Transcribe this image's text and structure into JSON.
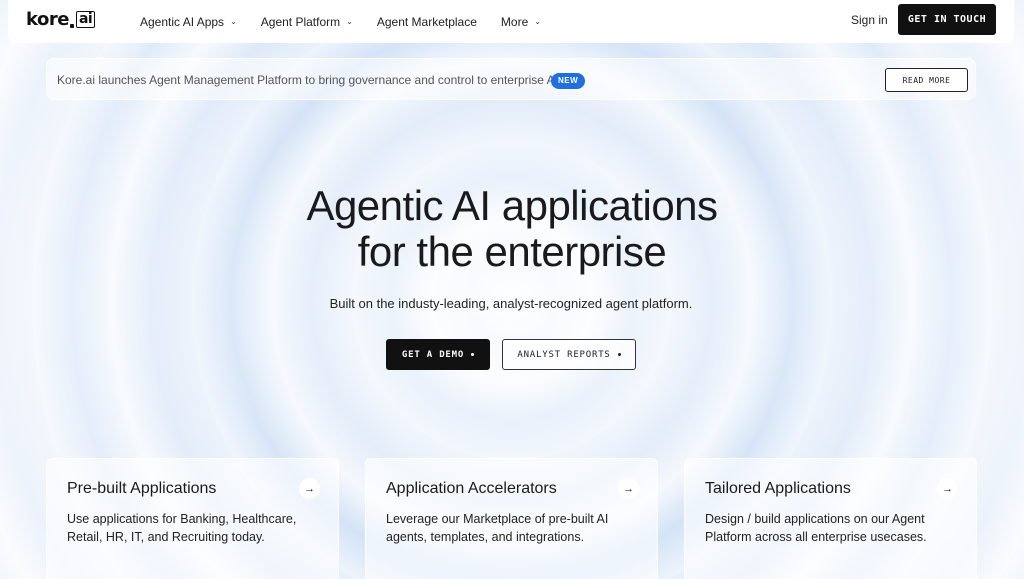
{
  "nav": {
    "logo_text": "kore",
    "logo_suffix": "ai",
    "links": [
      {
        "label": "Agentic AI Apps",
        "dropdown": true
      },
      {
        "label": "Agent Platform",
        "dropdown": true
      },
      {
        "label": "Agent Marketplace",
        "dropdown": false
      },
      {
        "label": "More",
        "dropdown": true
      }
    ],
    "sign_in": "Sign in",
    "cta": "GET IN TOUCH"
  },
  "announcement": {
    "text": "Kore.ai launches Agent Management Platform to bring governance and control to enterprise AI",
    "badge": "NEW",
    "button": "READ MORE"
  },
  "hero": {
    "title_line1": "Agentic AI applications",
    "title_line2": "for the enterprise",
    "subtitle": "Built on the industy-leading, analyst-recognized agent platform.",
    "primary_button": "GET A DEMO",
    "secondary_button": "ANALYST REPORTS"
  },
  "cards": [
    {
      "title": "Pre-built Applications",
      "description": "Use applications for Banking, Healthcare, Retail, HR, IT, and Recruiting today."
    },
    {
      "title": "Application Accelerators",
      "description": "Leverage our Marketplace of pre-built AI agents, templates, and integrations."
    },
    {
      "title": "Tailored Applications",
      "description": "Design / build applications on our Agent Platform across all enterprise usecases."
    }
  ],
  "colors": {
    "accent": "#1f6fe0",
    "button_dark": "#111111"
  }
}
